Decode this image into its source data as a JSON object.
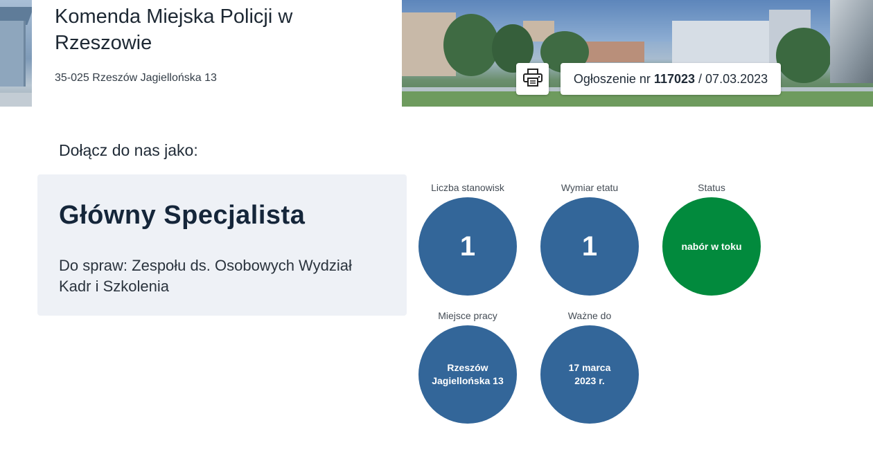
{
  "header": {
    "org_name": "Komenda Miejska Policji w Rzeszowie",
    "org_address": "35-025 Rzeszów Jagiellońska 13",
    "announcement": {
      "prefix": "Ogłoszenie nr",
      "number": "117023",
      "separator": "/",
      "date": "07.03.2023"
    },
    "print_icon": "printer-icon"
  },
  "main": {
    "join_heading": "Dołącz do nas jako:",
    "job_title": "Główny Specjalista",
    "job_subtitle": "Do spraw: Zespołu ds. Osobowych Wydział Kadr i Szkolenia",
    "stats": {
      "positions": {
        "label": "Liczba stanowisk",
        "value": "1"
      },
      "workload": {
        "label": "Wymiar etatu",
        "value": "1"
      },
      "status": {
        "label": "Status",
        "value": "nabór w toku"
      },
      "location": {
        "label": "Miejsce pracy",
        "line1": "Rzeszów",
        "line2": "Jagiellońska 13"
      },
      "valid_until": {
        "label": "Ważne do",
        "line1": "17 marca",
        "line2": "2023 r."
      }
    }
  },
  "colors": {
    "circle_blue": "#336699",
    "circle_green": "#028a3d",
    "card_bg": "#eef1f6"
  }
}
